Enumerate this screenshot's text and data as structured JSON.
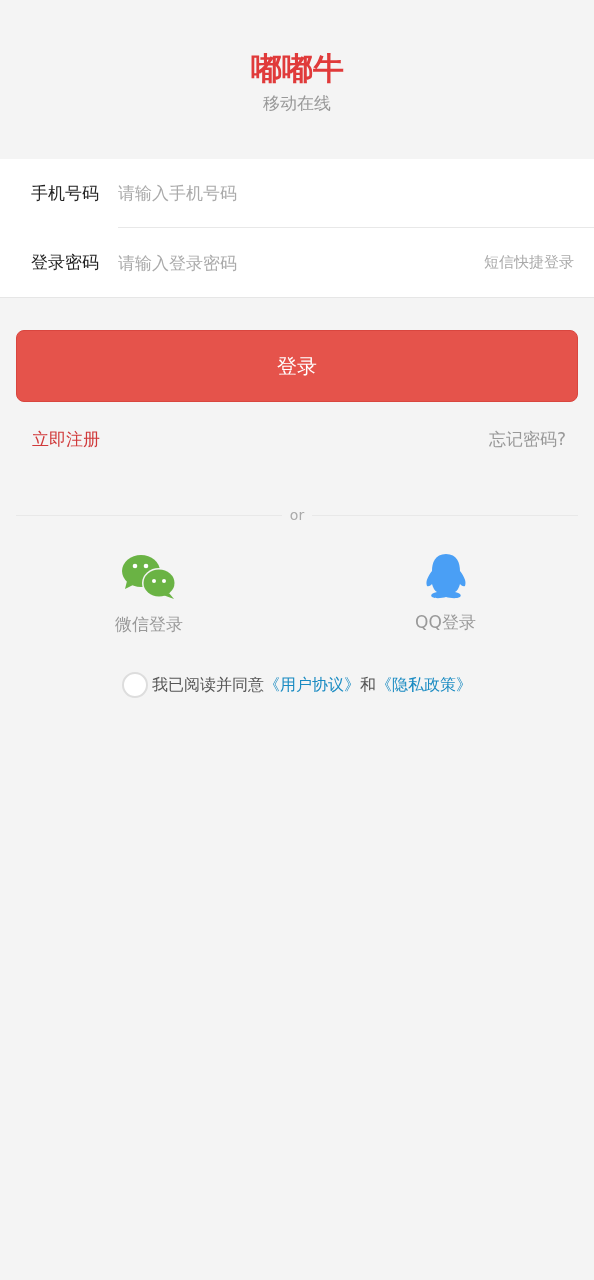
{
  "header": {
    "title": "嘟嘟牛",
    "subtitle": "移动在线"
  },
  "form": {
    "fields": [
      {
        "label": "手机号码",
        "placeholder": "请输入手机号码"
      },
      {
        "label": "登录密码",
        "placeholder": "请输入登录密码",
        "action": "短信快捷登录"
      }
    ]
  },
  "login_button": "登录",
  "links": {
    "register": "立即注册",
    "forgot": "忘记密码?"
  },
  "divider": "or",
  "social": [
    {
      "kind": "wechat",
      "label": "微信登录"
    },
    {
      "kind": "qq",
      "label": "QQ登录"
    }
  ],
  "agreement": {
    "checked": false,
    "parts": [
      {
        "kind": "text",
        "text": "我已阅读并同意"
      },
      {
        "kind": "link",
        "text": "《用户协议》"
      },
      {
        "kind": "text",
        "text": "和"
      },
      {
        "kind": "link",
        "text": "《隐私政策》"
      }
    ]
  }
}
